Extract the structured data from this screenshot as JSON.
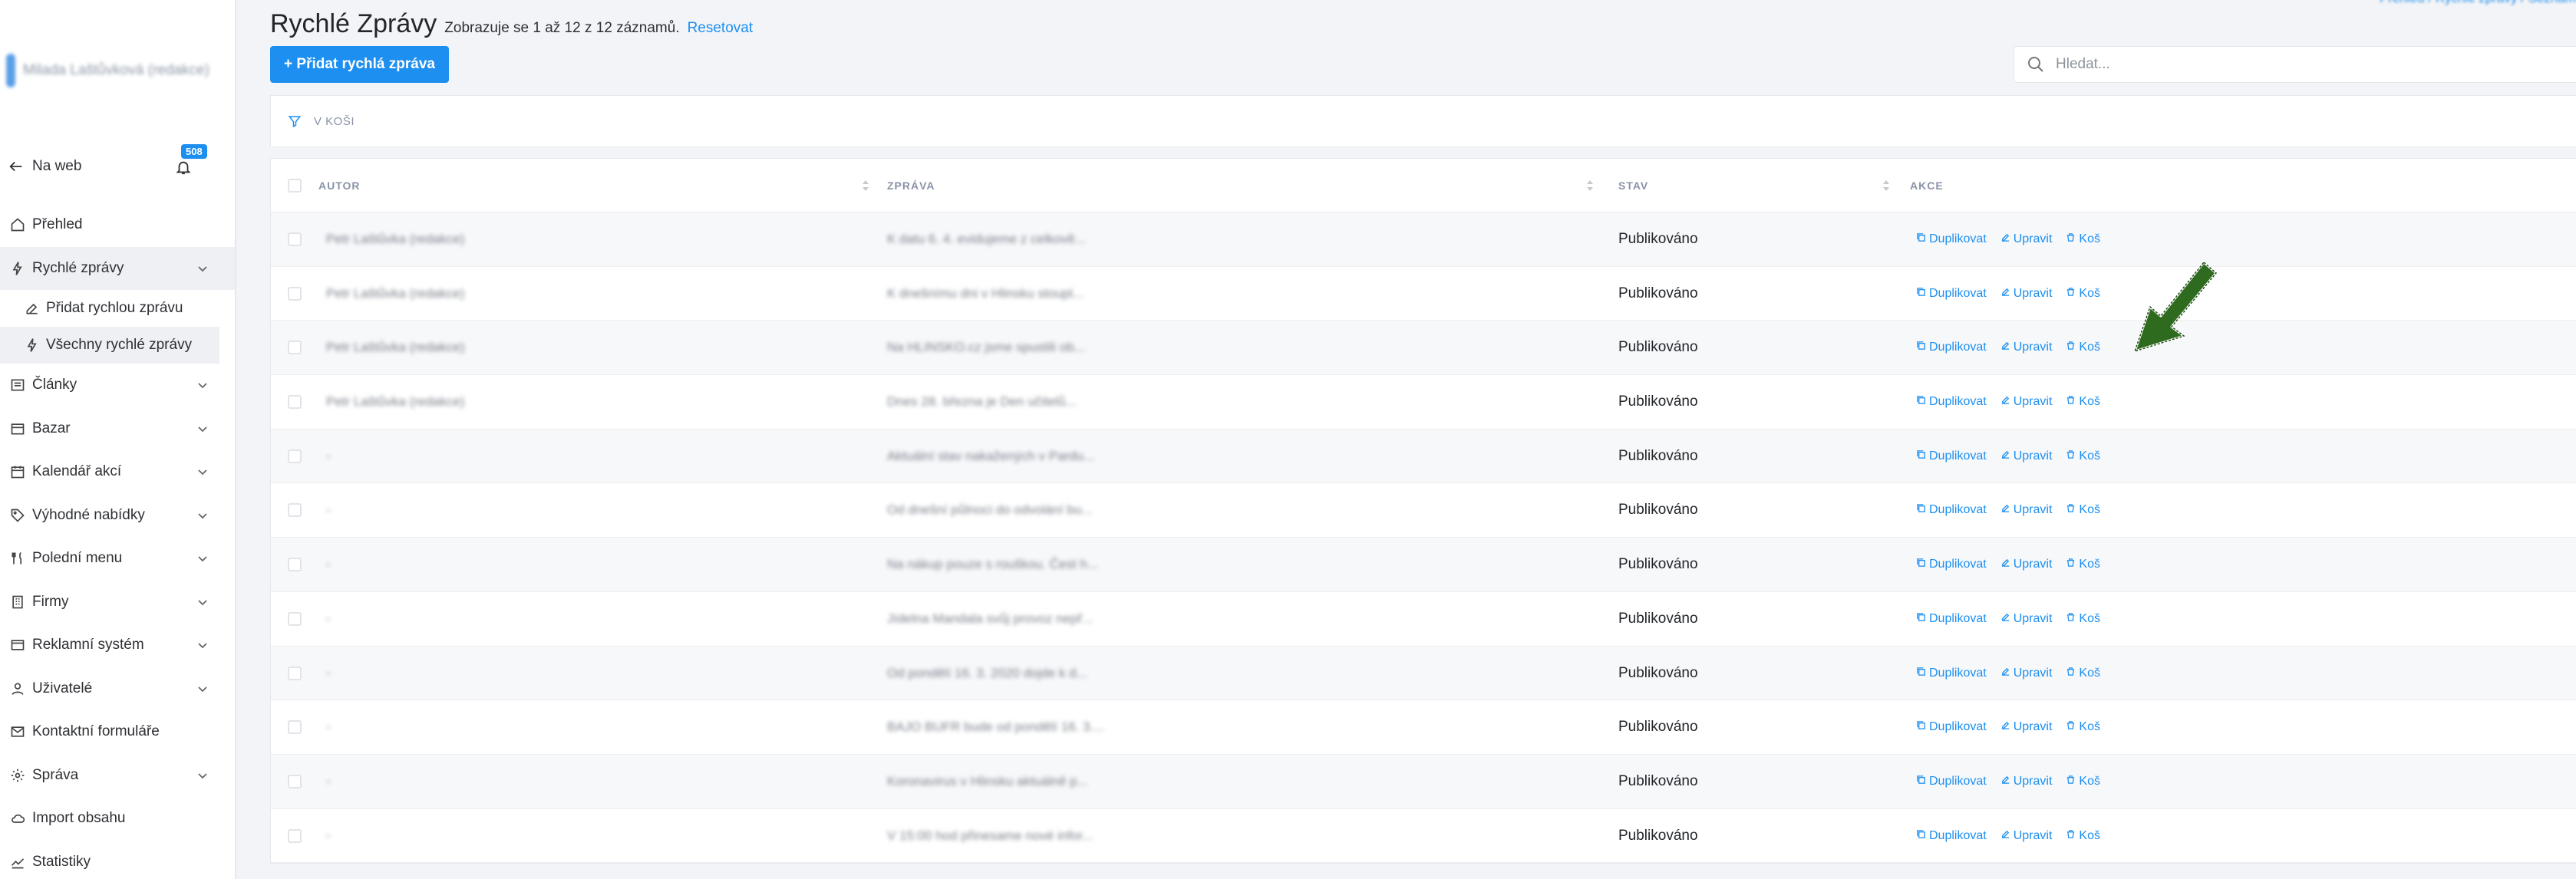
{
  "sidebar": {
    "brand_name": "Milada Laštůvková (redakce)",
    "back_label": "Na web",
    "notifications_count": "508",
    "items": [
      {
        "label": "Přehled",
        "icon": "home-icon",
        "expandable": false
      },
      {
        "label": "Rychlé zprávy",
        "icon": "bolt-icon",
        "expandable": true,
        "active": true
      },
      {
        "label": "Články",
        "icon": "list-icon",
        "expandable": true
      },
      {
        "label": "Bazar",
        "icon": "box-icon",
        "expandable": true
      },
      {
        "label": "Kalendář akcí",
        "icon": "calendar-icon",
        "expandable": true
      },
      {
        "label": "Výhodné nabídky",
        "icon": "tag-icon",
        "expandable": true
      },
      {
        "label": "Polední menu",
        "icon": "cutlery-icon",
        "expandable": true
      },
      {
        "label": "Firmy",
        "icon": "building-icon",
        "expandable": true
      },
      {
        "label": "Reklamní systém",
        "icon": "ad-icon",
        "expandable": true
      },
      {
        "label": "Uživatelé",
        "icon": "user-icon",
        "expandable": true
      },
      {
        "label": "Kontaktní formuláře",
        "icon": "mail-icon",
        "expandable": false
      },
      {
        "label": "Správa",
        "icon": "gear-icon",
        "expandable": true
      },
      {
        "label": "Import obsahu",
        "icon": "cloud-icon",
        "expandable": false
      },
      {
        "label": "Statistiky",
        "icon": "chart-icon",
        "expandable": false
      }
    ],
    "subitems": [
      {
        "label": "Přidat rychlou zprávu",
        "icon": "edit-icon"
      },
      {
        "label": "Všechny rychlé zprávy",
        "icon": "bolt-icon",
        "active": true
      }
    ]
  },
  "header": {
    "title": "Rychlé Zprávy",
    "meta": "Zobrazuje se 1 až 12 z 12 záznamů.",
    "reset": "Resetovat",
    "breadcrumbs": "Přehled / Rychlé zprávy / Seznam"
  },
  "toolbar": {
    "add_label": "+ Přidat rychlá zpráva",
    "search_placeholder": "Hledat..."
  },
  "filter": {
    "label": "V KOŠI"
  },
  "table": {
    "columns": [
      "AUTOR",
      "ZPRÁVA",
      "STAV",
      "AKCE"
    ],
    "action_labels": {
      "duplicate": "Duplikovat",
      "edit": "Upravit",
      "trash": "Koš"
    },
    "rows": [
      {
        "author": "Petr Laštůvka (redakce)",
        "message": "K datu 6. 4. evidujeme z celkově...",
        "status": "Publikováno"
      },
      {
        "author": "Petr Laštůvka (redakce)",
        "message": "K dnešnímu dni v Hlinsku stoupl...",
        "status": "Publikováno"
      },
      {
        "author": "Petr Laštůvka (redakce)",
        "message": "Na HLINSKO.cz jsme spustili ob...",
        "status": "Publikováno"
      },
      {
        "author": "Petr Laštůvka (redakce)",
        "message": "Dnes 28. března je Den učitelů...",
        "status": "Publikováno"
      },
      {
        "author": "-",
        "message": "Aktuální stav nakažených v Pardu...",
        "status": "Publikováno"
      },
      {
        "author": "-",
        "message": "Od dnešní půlnoci do odvolání bu...",
        "status": "Publikováno"
      },
      {
        "author": "-",
        "message": "Na nákup pouze s rouškou. Čest h...",
        "status": "Publikováno"
      },
      {
        "author": "-",
        "message": "Jídelna Mandala svůj provoz nepř...",
        "status": "Publikováno"
      },
      {
        "author": "-",
        "message": "Od pondělí 16. 3. 2020 dojde k d...",
        "status": "Publikováno"
      },
      {
        "author": "-",
        "message": "BAJO BUFR bude od pondělí 16. 3....",
        "status": "Publikováno"
      },
      {
        "author": "-",
        "message": "Koronavirus v Hlinsku aktuálně p...",
        "status": "Publikováno"
      },
      {
        "author": "-",
        "message": "V 15:00 hod přinesame nové infor...",
        "status": "Publikováno"
      }
    ]
  },
  "colors": {
    "accent": "#1d8ff0",
    "arrow": "#2f6b1f"
  }
}
